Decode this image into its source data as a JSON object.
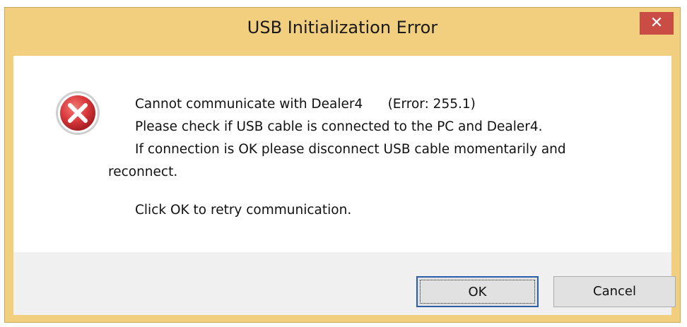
{
  "dialog": {
    "title": "USB Initialization Error",
    "close_glyph": "✕",
    "icon": "error-icon",
    "message": {
      "line1": "Cannot communicate with Dealer4      (Error: 255.1)",
      "line2": "Please check if USB cable is connected to the PC and Dealer4.",
      "line3": "If connection is OK please disconnect USB cable momentarily and",
      "line4": "reconnect.",
      "line5": "Click OK to retry communication."
    },
    "buttons": {
      "ok": "OK",
      "cancel": "Cancel"
    },
    "colors": {
      "frame": "#f1cf7f",
      "close": "#c94c45",
      "error_red": "#d9383a"
    }
  }
}
